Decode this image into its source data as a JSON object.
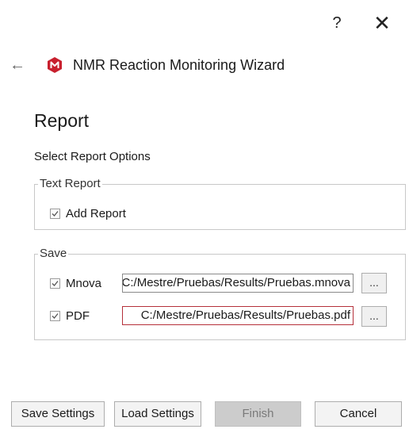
{
  "window": {
    "help_label": "?",
    "close_label": "✕"
  },
  "header": {
    "back_icon": "arrow-left-icon",
    "logo_icon": "mnova-logo-icon",
    "logo_color": "#c8202e",
    "title": "NMR Reaction Monitoring Wizard"
  },
  "page": {
    "title": "Report",
    "subtitle": "Select Report Options"
  },
  "text_report": {
    "legend": "Text Report",
    "add_report": {
      "label": "Add Report",
      "checked": true
    }
  },
  "save": {
    "legend": "Save",
    "mnova": {
      "label": "Mnova",
      "checked": true,
      "path": "C:/Mestre/Pruebas/Results/Pruebas.mnova",
      "browse_label": "..."
    },
    "pdf": {
      "label": "PDF",
      "checked": true,
      "path": "C:/Mestre/Pruebas/Results/Pruebas.pdf",
      "browse_label": "..."
    }
  },
  "footer": {
    "save_settings": "Save Settings",
    "load_settings": "Load Settings",
    "finish": "Finish",
    "cancel": "Cancel"
  },
  "colors": {
    "focus_border": "#b5303a",
    "disabled_button": "#cccccc"
  }
}
